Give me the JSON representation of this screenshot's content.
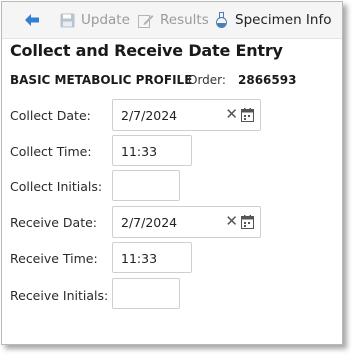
{
  "toolbar": {
    "back_icon": "arrow-left-icon",
    "update_label": "Update",
    "update_icon": "save-icon",
    "results_label": "Results",
    "results_icon": "edit-icon",
    "specimen_label": "Specimen Info",
    "specimen_icon": "flask-icon"
  },
  "header": {
    "title": "Collect and Receive Date Entry",
    "test_name": "BASIC METABOLIC PROFILE",
    "order_label": "Order:",
    "order_number": "2866593"
  },
  "form": {
    "collect_date_label": "Collect Date:",
    "collect_date_value": "2/7/2024",
    "collect_time_label": "Collect Time:",
    "collect_time_value": "11:33",
    "collect_initials_label": "Collect Initials:",
    "collect_initials_value": "",
    "receive_date_label": "Receive Date:",
    "receive_date_value": "2/7/2024",
    "receive_time_label": "Receive Time:",
    "receive_time_value": "11:33",
    "receive_initials_label": "Receive Initials:",
    "receive_initials_value": ""
  },
  "colors": {
    "accent_blue": "#2f7fd3",
    "disabled_text": "#9a9a9a"
  }
}
